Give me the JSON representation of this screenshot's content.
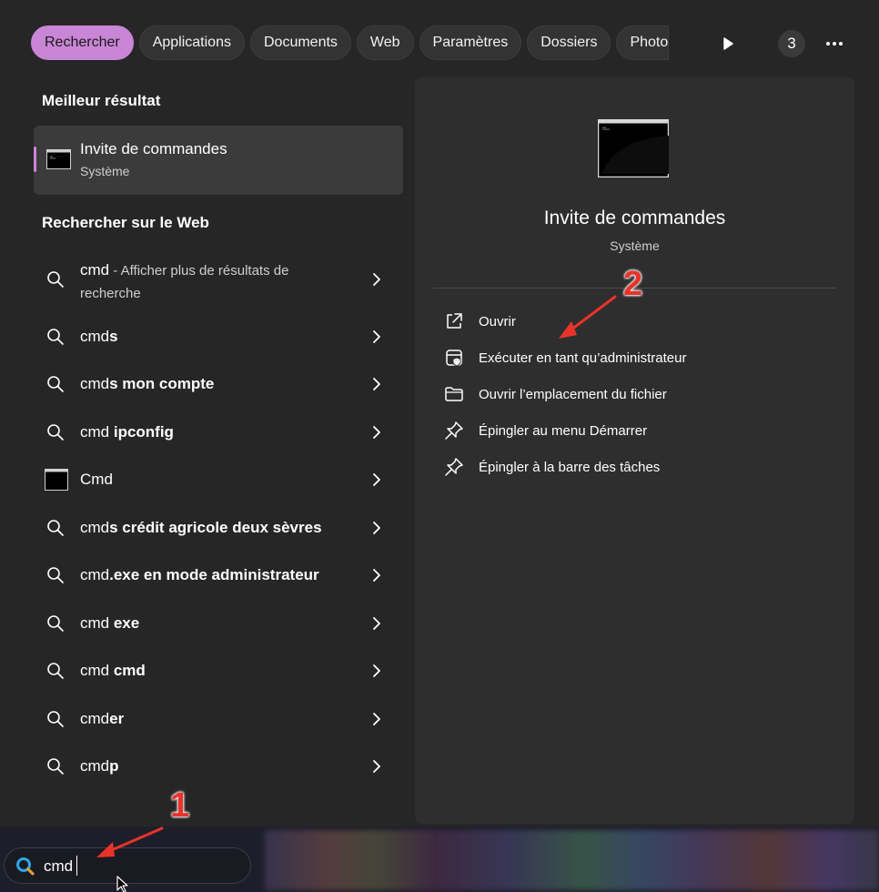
{
  "tabs": [
    "Rechercher",
    "Applications",
    "Documents",
    "Web",
    "Paramètres",
    "Dossiers",
    "Photo"
  ],
  "header": {
    "badge_count": "3",
    "play_icon": "play-icon",
    "more_icon": "more-icon"
  },
  "best_match": {
    "section_title": "Meilleur résultat",
    "title": "Invite de commandes",
    "subtitle": "Système"
  },
  "web": {
    "section_title": "Rechercher sur le Web",
    "first": {
      "query": "cmd",
      "suffix": " - Afficher plus de résultats de",
      "line2": "recherche"
    },
    "items": [
      {
        "q": "cmd",
        "rest": "s",
        "icon": "search-icon"
      },
      {
        "q": "cmd",
        "rest": "s mon compte",
        "icon": "search-icon"
      },
      {
        "q": "cmd ",
        "rest": "ipconfig",
        "icon": "search-icon"
      },
      {
        "q": "Cmd",
        "rest": "",
        "icon": "cmd-app-icon"
      },
      {
        "q": "cmd",
        "rest": "s crédit agricole deux sèvres",
        "icon": "search-icon"
      },
      {
        "q": "cmd",
        "rest": ".exe en mode administrateur",
        "icon": "search-icon"
      },
      {
        "q": "cmd ",
        "rest": "exe",
        "icon": "search-icon"
      },
      {
        "q": "cmd ",
        "rest": "cmd",
        "icon": "search-icon"
      },
      {
        "q": "cmd",
        "rest": "er",
        "icon": "search-icon"
      },
      {
        "q": "cmd",
        "rest": "p",
        "icon": "search-icon"
      }
    ]
  },
  "detail": {
    "title": "Invite de commandes",
    "subtitle": "Système",
    "actions": [
      {
        "label": "Ouvrir",
        "icon": "open-external-icon"
      },
      {
        "label": "Exécuter en tant qu’administrateur",
        "icon": "run-as-admin-icon"
      },
      {
        "label": "Ouvrir l’emplacement du fichier",
        "icon": "folder-icon"
      },
      {
        "label": "Épingler au menu Démarrer",
        "icon": "pin-icon"
      },
      {
        "label": "Épingler à la barre des tâches",
        "icon": "pin-icon"
      }
    ]
  },
  "taskbar": {
    "search_value": "cmd"
  },
  "annotations": {
    "step1": "1",
    "step2": "2"
  },
  "colors": {
    "accent": "#c986d6",
    "annotation": "#e8332b",
    "panel": "#262626",
    "detail_panel": "#2e2e2e"
  }
}
